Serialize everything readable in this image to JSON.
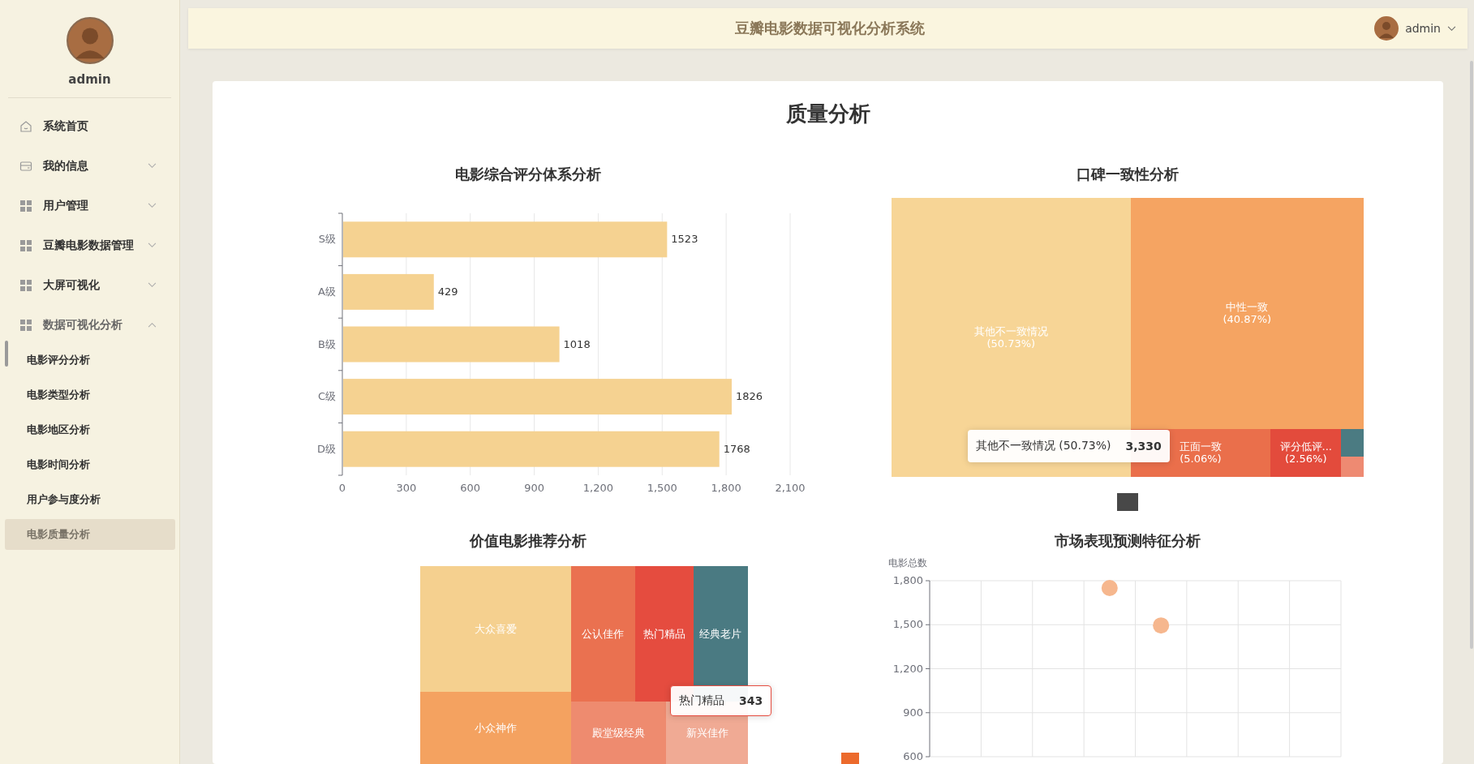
{
  "sidebar": {
    "username": "admin",
    "menu": [
      {
        "kind": "link",
        "label": "系统首页"
      },
      {
        "kind": "group",
        "label": "我的信息",
        "expanded": false
      },
      {
        "kind": "group",
        "label": "用户管理",
        "expanded": false
      },
      {
        "kind": "group",
        "label": "豆瓣电影数据管理",
        "expanded": false
      },
      {
        "kind": "group",
        "label": "大屏可视化",
        "expanded": false
      },
      {
        "kind": "group",
        "label": "数据可视化分析",
        "expanded": true,
        "children": [
          {
            "label": "电影评分分析",
            "selected": false
          },
          {
            "label": "电影类型分析",
            "selected": false
          },
          {
            "label": "电影地区分析",
            "selected": false
          },
          {
            "label": "电影时间分析",
            "selected": false
          },
          {
            "label": "用户参与度分析",
            "selected": false
          },
          {
            "label": "电影质量分析",
            "selected": true
          }
        ]
      }
    ]
  },
  "header": {
    "title": "豆瓣电影数据可视化分析系统",
    "user": "admin"
  },
  "page": {
    "title": "质量分析",
    "panels": [
      {
        "kind": "chart",
        "title": "电影综合评分体系分析",
        "chart_data": {
          "type": "bar",
          "orientation": "horizontal",
          "categories": [
            "S级",
            "A级",
            "B级",
            "C级",
            "D级"
          ],
          "values": [
            1523,
            429,
            1018,
            1826,
            1768
          ],
          "xlim": [
            0,
            2100
          ],
          "xticks": [
            0,
            300,
            600,
            900,
            {
              "value": 1200,
              "label": "1,200"
            },
            {
              "value": 1500,
              "label": "1,500"
            },
            {
              "value": 1800,
              "label": "1,800"
            },
            {
              "value": 2100,
              "label": "2,100"
            }
          ],
          "grid": true,
          "data_labels": true
        }
      },
      {
        "kind": "treemap",
        "title": "口碑一致性分析",
        "breadcrumb": {
          "color": "#484848"
        },
        "cells": [
          {
            "label": "其他不一致情况",
            "share": "(50.73%)",
            "color": "#f7d596"
          },
          {
            "label": "中性一致",
            "share": "(40.87%)",
            "color": "#f5a462"
          },
          {
            "label": "正面一致",
            "share": "(5.06%)",
            "color": "#ea6f4b"
          },
          {
            "label": "评分低评...",
            "share": "(2.56%)",
            "color": "#e34b3c"
          },
          {
            "color": "#4b7b82"
          },
          {
            "color": "#ee8a72"
          }
        ],
        "tooltip": {
          "label": "其他不一致情况 (50.73%)",
          "value": "3,330"
        }
      },
      {
        "kind": "treemap",
        "title": "价值电影推荐分析",
        "breadcrumb": {
          "color": "#ec6a2c"
        },
        "cells": [
          {
            "label": "大众喜爱",
            "color": "#f5d08f"
          },
          {
            "label": "公认佳作",
            "color": "#ea7150"
          },
          {
            "label": "热门精品",
            "color": "#e54c3f"
          },
          {
            "label": "经典老片",
            "color": "#4a7a82"
          },
          {
            "label": "小众神作",
            "color": "#f4a260"
          },
          {
            "label": "殿堂级经典",
            "color": "#ee8b6f"
          },
          {
            "label": "新兴佳作",
            "color": "#f0aa94"
          }
        ],
        "tooltip": {
          "label": "热门精品",
          "value": "343"
        }
      },
      {
        "kind": "chart",
        "title": "市场表现预测特征分析",
        "chart_data": {
          "type": "scatter",
          "ylabel": "电影总数",
          "categories": [
            null,
            null,
            null,
            null,
            null,
            null,
            null,
            null
          ],
          "series": [
            {
              "color": "#f6b78e",
              "values": [
                null,
                null,
                null,
                1750,
                1495,
                null,
                null,
                null
              ]
            }
          ],
          "ylim": [
            600,
            1800
          ],
          "yticks": [
            600,
            900,
            {
              "value": 1200,
              "label": "1,200"
            },
            {
              "value": 1500,
              "label": "1,500"
            },
            {
              "value": 1800,
              "label": "1,800"
            }
          ],
          "grid": true
        }
      }
    ]
  }
}
